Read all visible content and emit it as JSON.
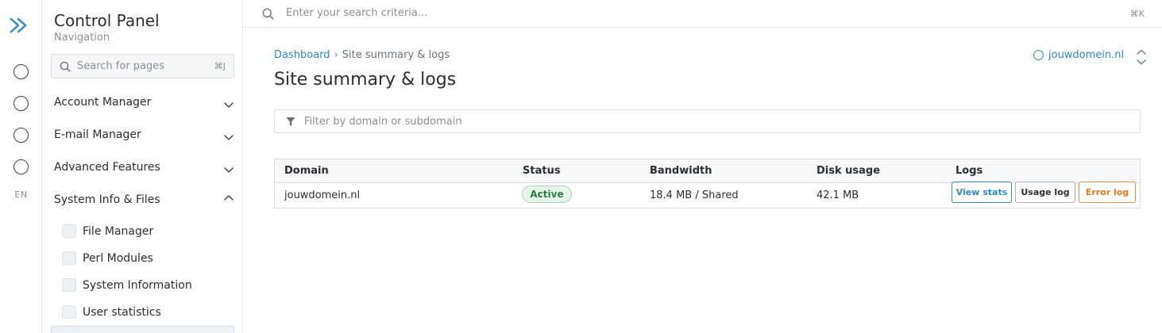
{
  "rail": {
    "language": "EN"
  },
  "sidebar": {
    "title": "Control Panel",
    "subtitle": "Navigation",
    "search_placeholder": "Search for pages",
    "search_shortcut": "⌘J",
    "sections": [
      {
        "label": "Account Manager",
        "expanded": false
      },
      {
        "label": "E-mail Manager",
        "expanded": false
      },
      {
        "label": "Advanced Features",
        "expanded": false
      },
      {
        "label": "System Info & Files",
        "expanded": true
      }
    ],
    "sub_items": [
      {
        "label": "File Manager"
      },
      {
        "label": "Perl Modules"
      },
      {
        "label": "System Information"
      },
      {
        "label": "User statistics"
      }
    ]
  },
  "topbar": {
    "search_placeholder": "Enter your search criteria...",
    "shortcut": "⌘K"
  },
  "breadcrumb": {
    "root": "Dashboard",
    "separator": "›",
    "current": "Site summary & logs"
  },
  "page": {
    "title": "Site summary & logs"
  },
  "domain_selector": {
    "value": "jouwdomein.nl"
  },
  "filter": {
    "placeholder": "Filter by domain or subdomain"
  },
  "table": {
    "columns": [
      "Domain",
      "Status",
      "Bandwidth",
      "Disk usage",
      "Logs"
    ],
    "rows": [
      {
        "domain": "jouwdomein.nl",
        "status": "Active",
        "bandwidth": "18.4 MB / Shared",
        "disk_usage": "42.1 MB",
        "actions": [
          "View stats",
          "Usage log",
          "Error log"
        ]
      }
    ]
  },
  "colors": {
    "accent": "#2f8ac6",
    "success": "#2d7a46",
    "warning": "#e07b1f"
  }
}
